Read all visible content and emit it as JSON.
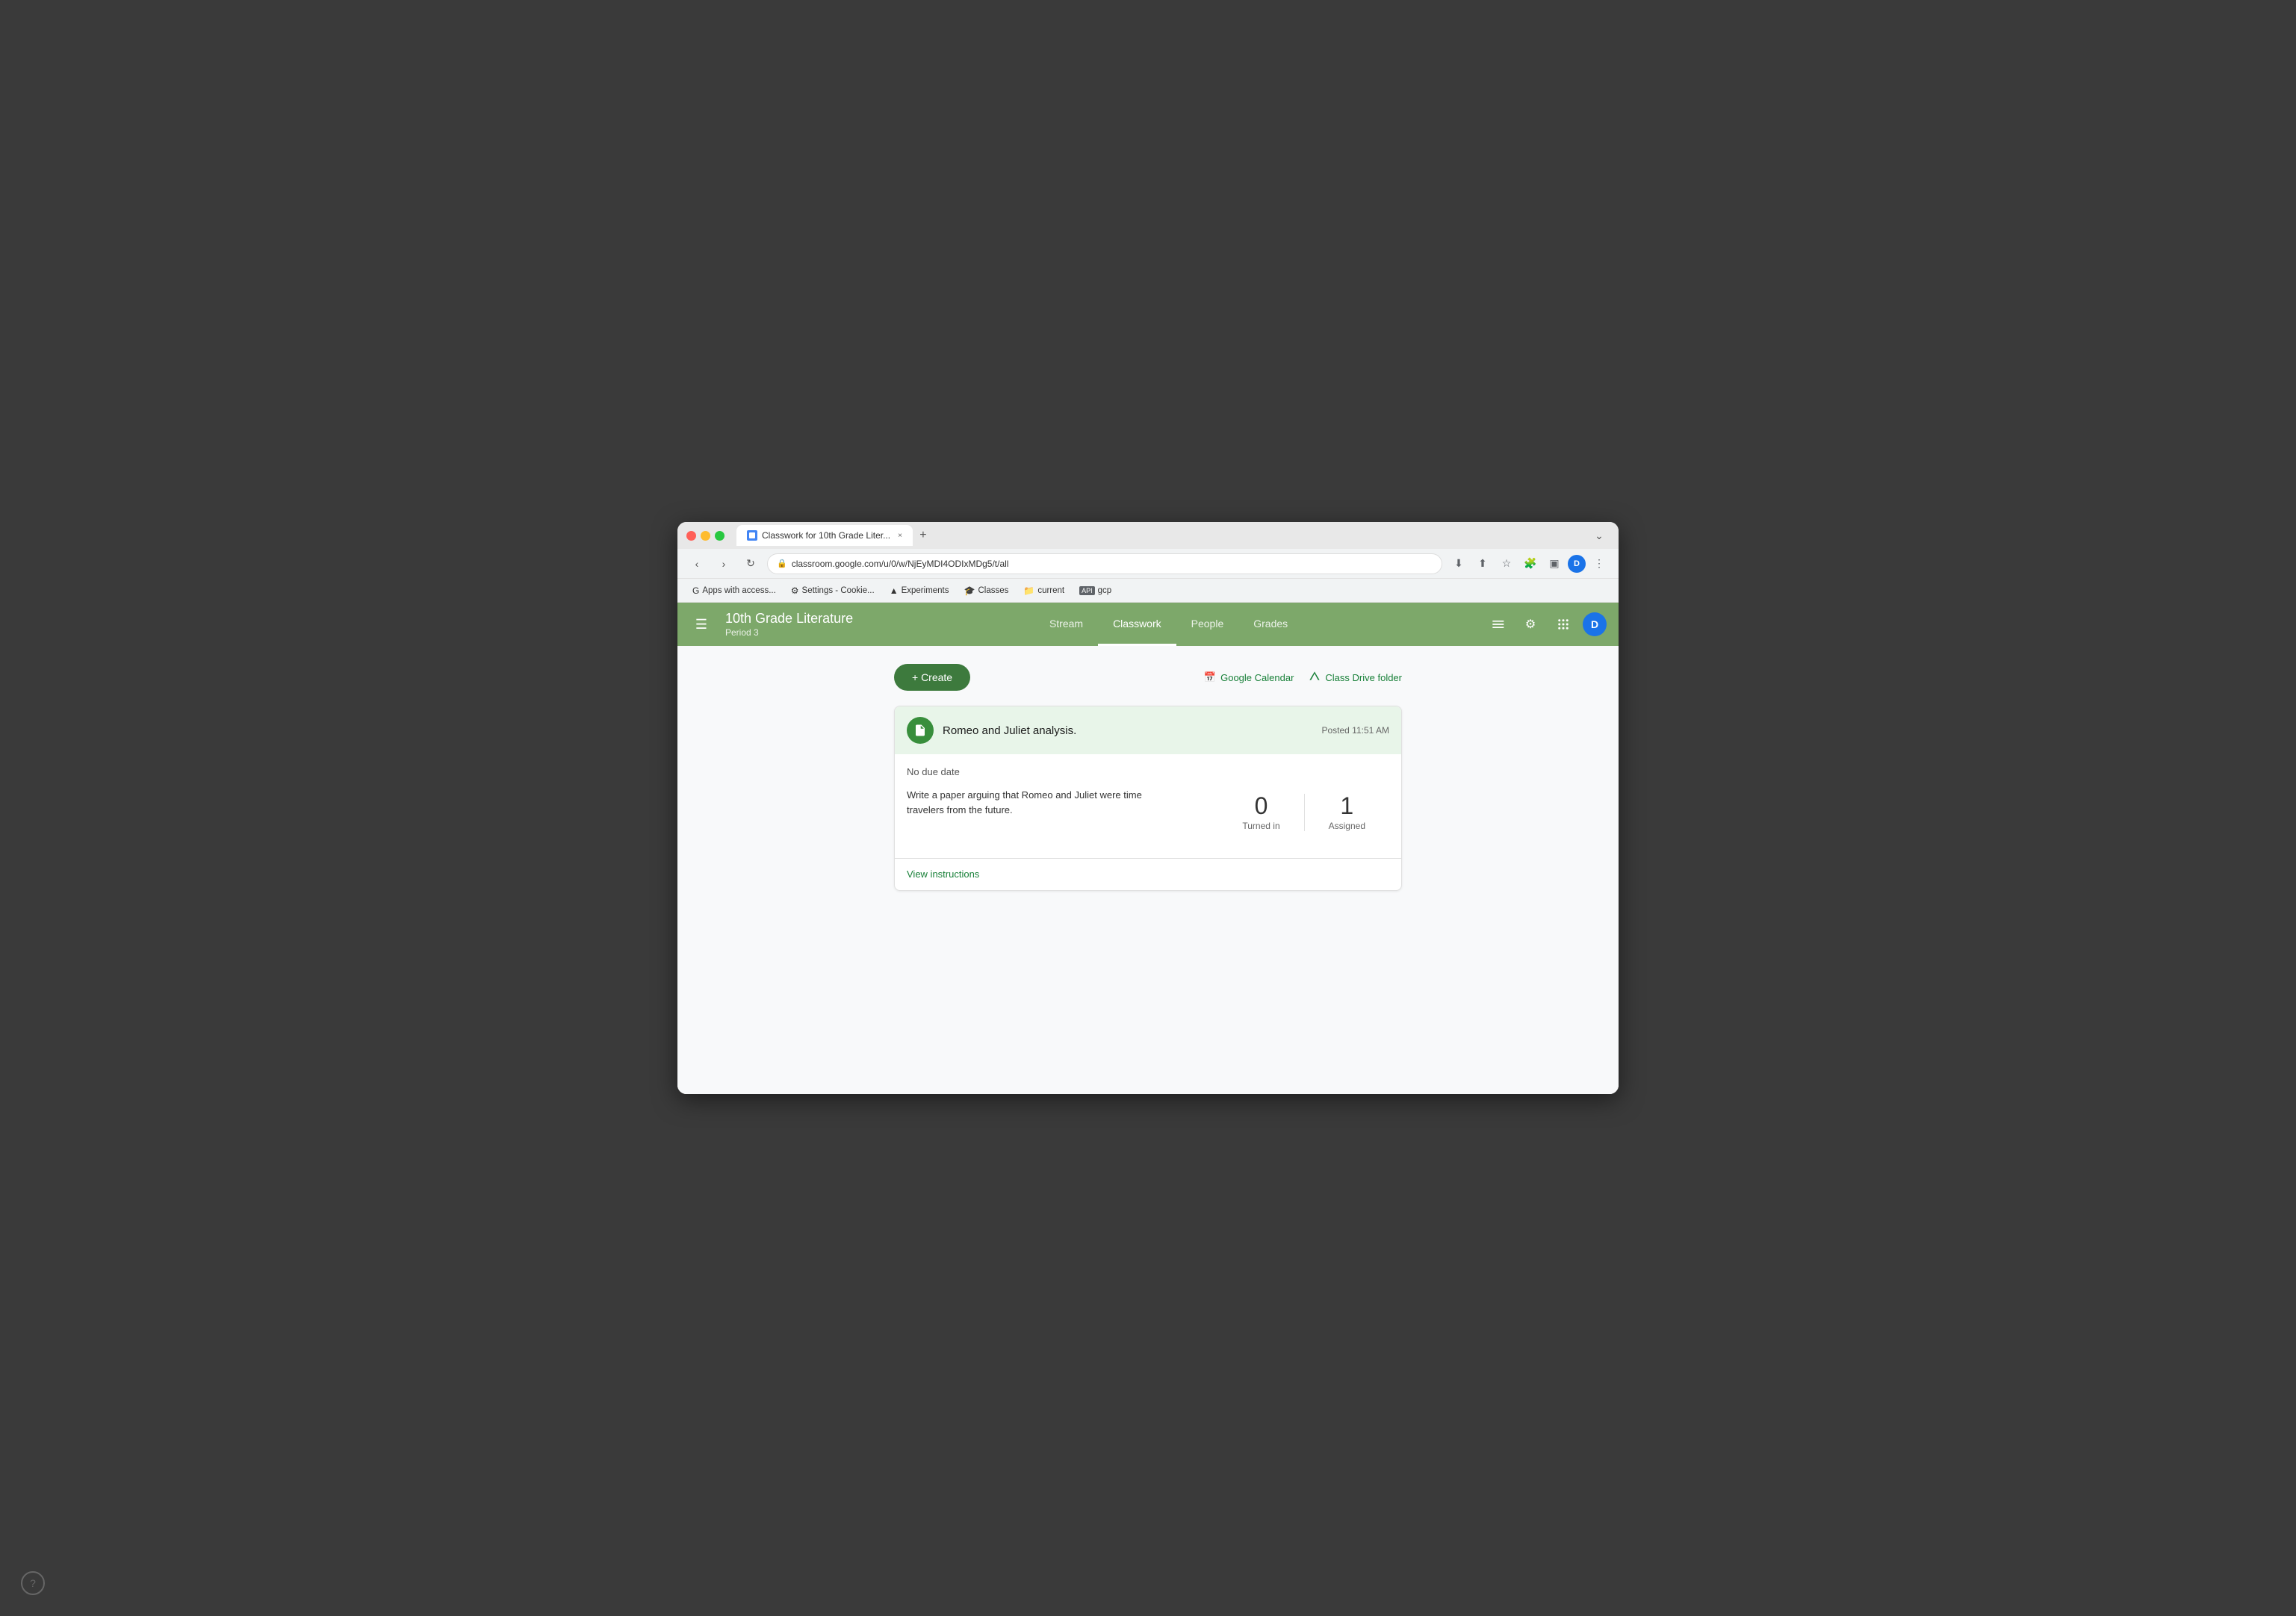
{
  "browser": {
    "tab_title": "Classwork for 10th Grade Liter...",
    "tab_close": "×",
    "tab_new": "+",
    "url": "classroom.google.com/u/0/w/NjEyMDI4ODIxMDg5/t/all",
    "profile_letter": "D",
    "nav": {
      "back": "‹",
      "forward": "›",
      "refresh": "↺"
    },
    "bookmarks": [
      {
        "icon": "G",
        "label": "Apps with access..."
      },
      {
        "icon": "⚙",
        "label": "Settings - Cookie..."
      },
      {
        "icon": "▲",
        "label": "Experiments"
      },
      {
        "icon": "🎓",
        "label": "Classes"
      },
      {
        "icon": "📁",
        "label": "current"
      },
      {
        "icon": "API",
        "label": "gcp"
      }
    ]
  },
  "classroom": {
    "class_title": "10th Grade Literature",
    "class_period": "Period 3",
    "nav_tabs": [
      {
        "id": "stream",
        "label": "Stream",
        "active": false
      },
      {
        "id": "classwork",
        "label": "Classwork",
        "active": true
      },
      {
        "id": "people",
        "label": "People",
        "active": false
      },
      {
        "id": "grades",
        "label": "Grades",
        "active": false
      }
    ],
    "header_avatar_letter": "D"
  },
  "toolbar": {
    "create_label": "+ Create",
    "google_calendar_label": "Google Calendar",
    "class_drive_folder_label": "Class Drive folder"
  },
  "assignment": {
    "title": "Romeo and Juliet analysis.",
    "posted_time": "Posted 11:51 AM",
    "no_due_date": "No due date",
    "description": "Write a paper arguing that Romeo and Juliet were time travelers from the future.",
    "turned_in_count": "0",
    "turned_in_label": "Turned in",
    "assigned_count": "1",
    "assigned_label": "Assigned",
    "view_instructions_label": "View instructions"
  },
  "icons": {
    "menu": "☰",
    "calendar": "📅",
    "drive": "△",
    "assignment": "☰",
    "help": "?",
    "plus": "+",
    "grid": "⋮⋮⋮",
    "settings": "⚙",
    "lock": "🔒"
  }
}
